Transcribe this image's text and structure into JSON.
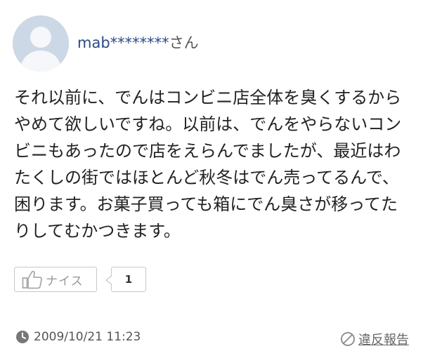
{
  "comment": {
    "username": "mab********",
    "honorific": "さん",
    "body_lines": [
      "それ以前に、でんはコンビニ店全体を臭くするから",
      "やめて欲しいですね。以前は、でんをやらないコン",
      "ビニもあったので店をえらんでましたが、最近はわ",
      "たくしの街ではほとんど秋冬はでん売ってるんで、",
      "困ります。お菓子買っても箱にでん臭さが移ってた",
      "りしてむかつきます。"
    ],
    "like_label": "ナイス",
    "like_count": "1",
    "timestamp": "2009/10/21 11:23",
    "report_label": "違反報告"
  },
  "icons": {
    "avatar": "default-user-avatar-icon",
    "thumb": "thumbs-up-icon",
    "clock": "clock-icon",
    "report": "prohibited-icon"
  },
  "colors": {
    "username": "#2b4a8a",
    "avatar_bg": "#cdd8e6",
    "border": "#c7c7c7"
  }
}
